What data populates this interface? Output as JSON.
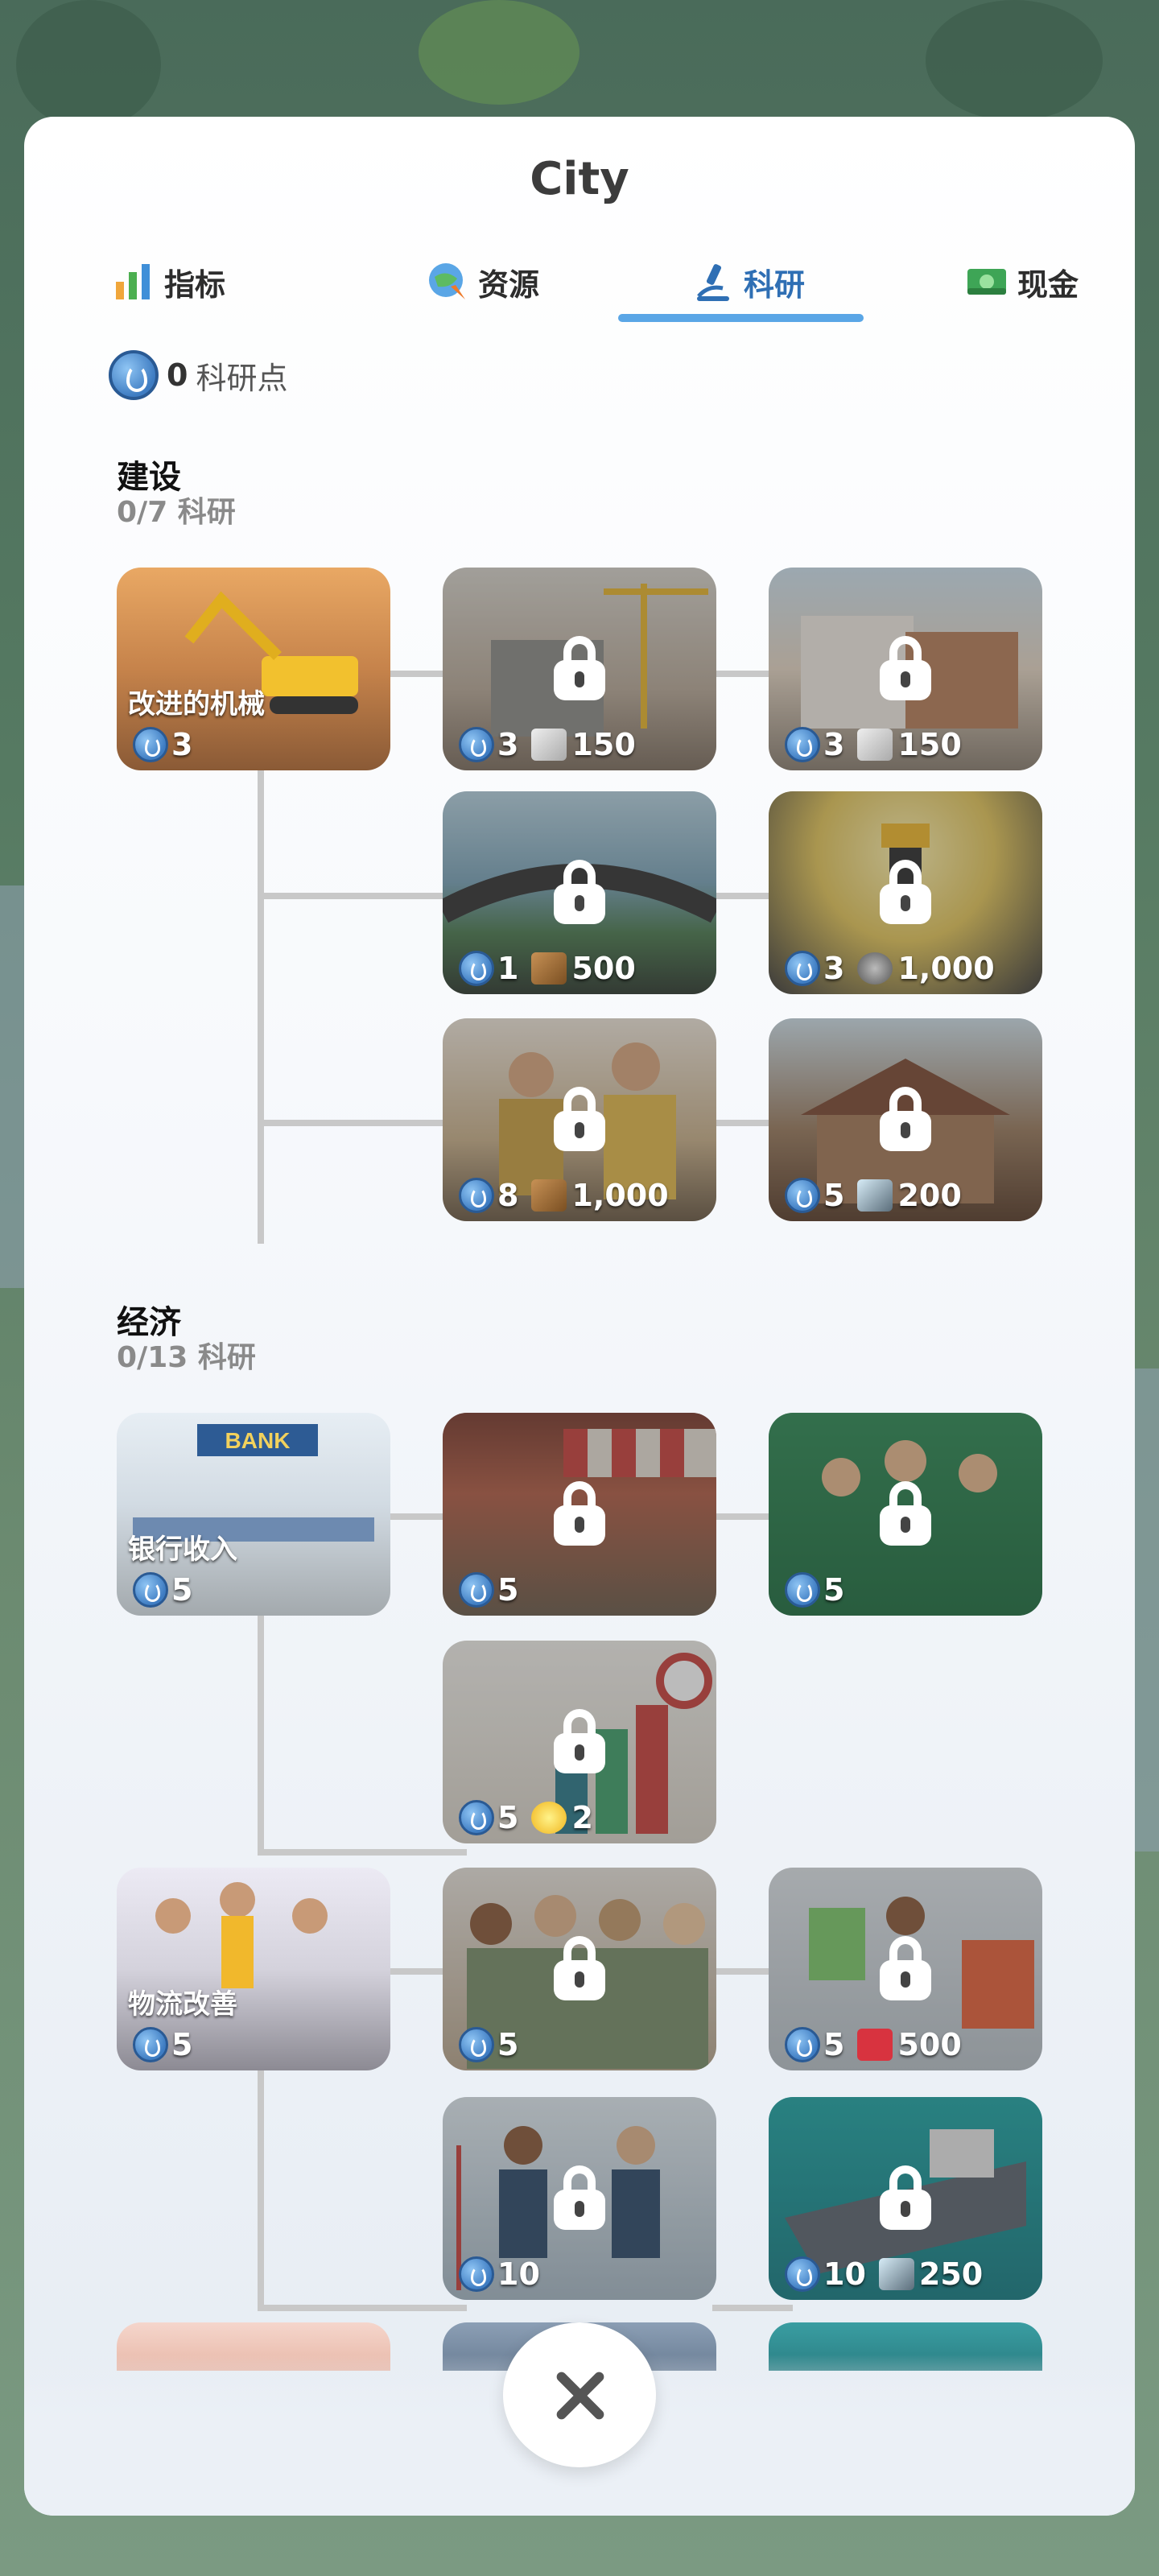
{
  "header": {
    "title": "City"
  },
  "tabs": [
    {
      "label": "指标",
      "icon": "bar-chart-icon"
    },
    {
      "label": "资源",
      "icon": "globe-carrot-icon"
    },
    {
      "label": "科研",
      "icon": "microscope-icon",
      "active": true
    },
    {
      "label": "现金",
      "icon": "cash-icon"
    }
  ],
  "research_points": {
    "value": "0",
    "label": "科研点"
  },
  "sections": [
    {
      "title": "建设",
      "count": "0/7  科研",
      "cards": [
        {
          "label": "改进的机械",
          "points": "3",
          "resource": "",
          "amount": "",
          "locked": false
        },
        {
          "label": "",
          "points": "3",
          "resource": "steel-icon",
          "amount": "150",
          "locked": true
        },
        {
          "label": "",
          "points": "3",
          "resource": "steel-icon",
          "amount": "150",
          "locked": true
        },
        {
          "label": "",
          "points": "1",
          "resource": "wood-icon",
          "amount": "500",
          "locked": true
        },
        {
          "label": "",
          "points": "3",
          "resource": "stone-icon",
          "amount": "1,000",
          "locked": true
        },
        {
          "label": "",
          "points": "8",
          "resource": "wood-icon",
          "amount": "1,000",
          "locked": true
        },
        {
          "label": "",
          "points": "5",
          "resource": "glass-icon",
          "amount": "200",
          "locked": true
        }
      ]
    },
    {
      "title": "经济",
      "count": "0/13  科研",
      "cards": [
        {
          "label": "银行收入",
          "points": "5",
          "resource": "",
          "amount": "",
          "locked": false
        },
        {
          "label": "",
          "points": "5",
          "resource": "",
          "amount": "",
          "locked": true
        },
        {
          "label": "",
          "points": "5",
          "resource": "",
          "amount": "",
          "locked": true
        },
        {
          "label": "",
          "points": "5",
          "resource": "lightbulb-icon",
          "amount": "2",
          "locked": true
        },
        {
          "label": "物流改善",
          "points": "5",
          "resource": "",
          "amount": "",
          "locked": false
        },
        {
          "label": "",
          "points": "5",
          "resource": "",
          "amount": "",
          "locked": true
        },
        {
          "label": "",
          "points": "5",
          "resource": "clothes-icon",
          "amount": "500",
          "locked": true
        },
        {
          "label": "",
          "points": "10",
          "resource": "",
          "amount": "",
          "locked": true
        },
        {
          "label": "",
          "points": "10",
          "resource": "glass-icon",
          "amount": "250",
          "locked": true
        }
      ]
    }
  ],
  "colors": {
    "accent": "#5aa6e6",
    "active_tab": "#2f6fb4",
    "panel": "#ffffff"
  }
}
